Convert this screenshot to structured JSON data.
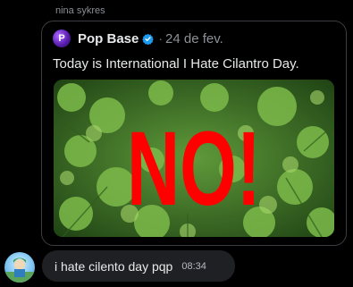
{
  "sender": {
    "name": "nina sykres"
  },
  "quoted_post": {
    "avatar_letter": "P",
    "author": "Pop Base",
    "separator": "·",
    "date": "24 de fev.",
    "text": "Today is International I Hate Cilantro Day.",
    "image_overlay_text": "NO!",
    "overlay_color": "#ff0000",
    "verified_color": "#1d9bf0"
  },
  "reply": {
    "text": "i hate cilento day pqp",
    "time": "08:34"
  }
}
